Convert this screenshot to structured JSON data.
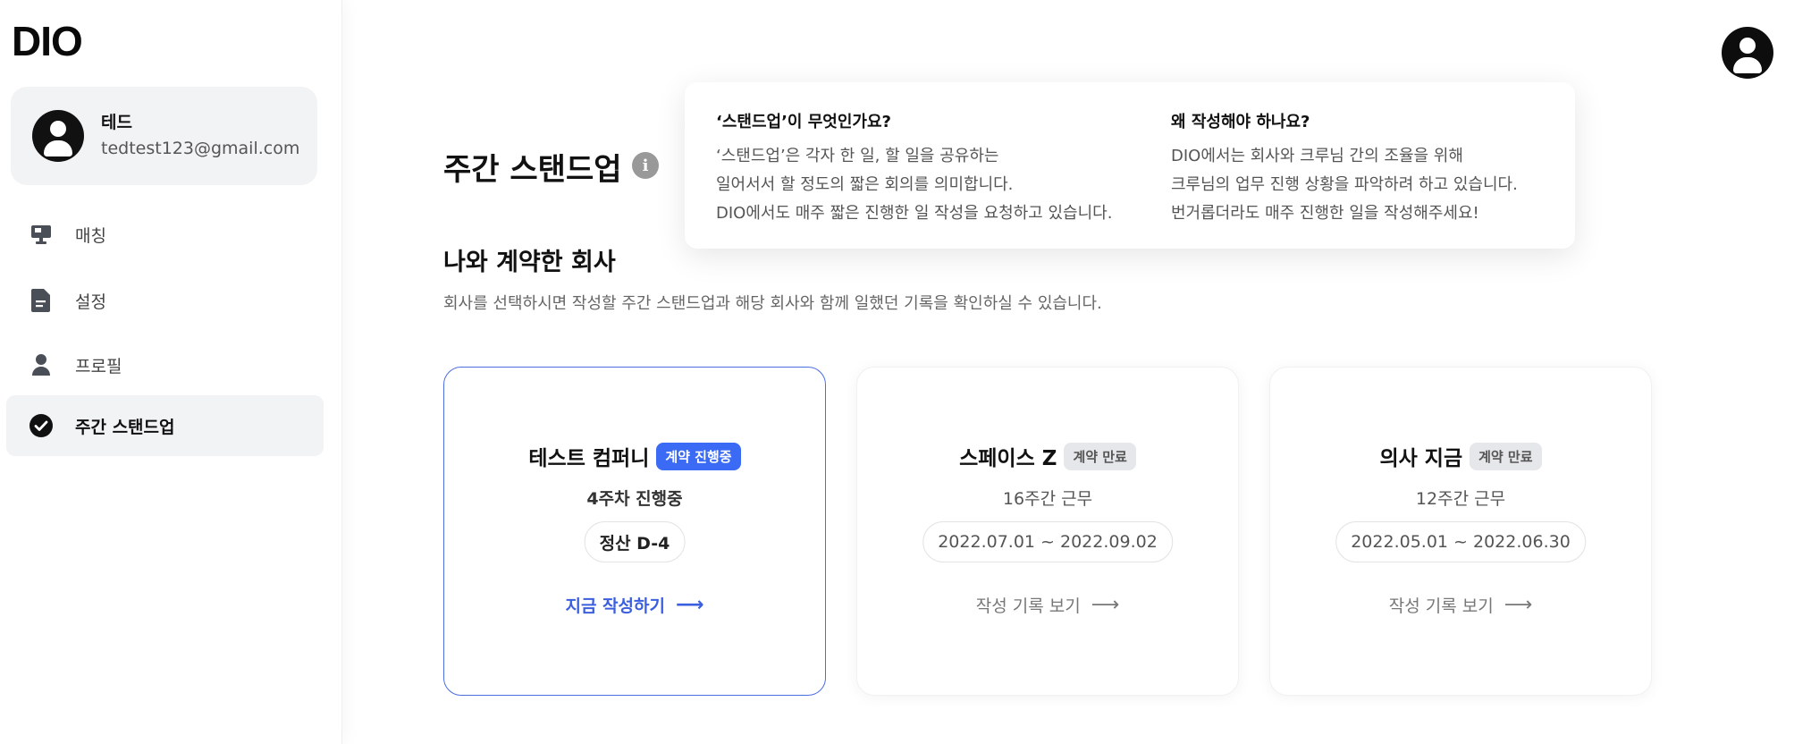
{
  "app": {
    "logo": "DIO"
  },
  "user": {
    "name": "테드",
    "email": "tedtest123@gmail.com"
  },
  "sidebar": {
    "items": [
      {
        "label": "매칭",
        "icon": "monitor-icon"
      },
      {
        "label": "설정",
        "icon": "document-icon"
      },
      {
        "label": "프로필",
        "icon": "person-icon"
      },
      {
        "label": "주간 스탠드업",
        "icon": "check-circle-icon",
        "active": true
      }
    ]
  },
  "header": {
    "title": "주간 스탠드업",
    "info_icon": "i"
  },
  "tooltip": {
    "col1": {
      "title": "‘스탠드업’이 무엇인가요?",
      "lines": [
        "‘스탠드업’은 각자 한 일, 할 일을 공유하는",
        "일어서서 할 정도의 짧은 회의를 의미합니다.",
        "DIO에서도 매주 짧은 진행한 일 작성을 요청하고 있습니다."
      ]
    },
    "col2": {
      "title": "왜 작성해야 하나요?",
      "lines": [
        "DIO에서는 회사와 크루님 간의 조율을 위해",
        "크루님의 업무 진행 상황을 파악하려 하고 있습니다.",
        "번거롭더라도 매주 진행한 일을 작성해주세요!"
      ]
    }
  },
  "section": {
    "title": "나와 계약한 회사",
    "description": "회사를 선택하시면 작성할 주간 스탠드업과 해당 회사와 함께 일했던 기록을 확인하실 수 있습니다."
  },
  "cards": [
    {
      "company": "테스트 컴퍼니",
      "badge": "계약 진행중",
      "week": "4주차 진행중",
      "pill": "정산 D-4",
      "action": "지금 작성하기",
      "arrow": "⟶"
    },
    {
      "company": "스페이스 Z",
      "badge": "계약 만료",
      "week": "16주간 근무",
      "pill": "2022.07.01 ~ 2022.09.02",
      "action": "작성 기록 보기",
      "arrow": "⟶"
    },
    {
      "company": "의사 지금",
      "badge": "계약 만료",
      "week": "12주간 근무",
      "pill": "2022.05.01 ~ 2022.06.30",
      "action": "작성 기록 보기",
      "arrow": "⟶"
    }
  ],
  "colors": {
    "accent": "#3b6af5",
    "link_blue": "#3b5fdf",
    "selected_border": "#4d6ee3"
  }
}
